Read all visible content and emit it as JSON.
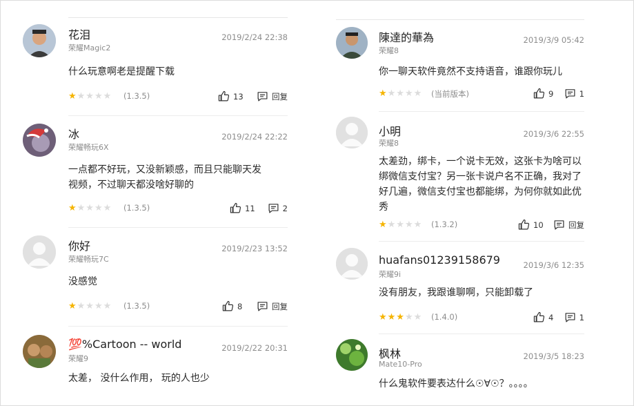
{
  "left_column": [
    {
      "name": "花泪",
      "device": "荣耀Magic2",
      "date": "2019/2/24 22:38",
      "text": "什么玩意啊老是提醒下载",
      "rating": 1,
      "version": "(1.3.5)",
      "likes": "13",
      "reply": "回复",
      "avatar": "avatar-photo-man"
    },
    {
      "name": "冰",
      "device": "荣耀畅玩6X",
      "date": "2019/2/24 22:22",
      "text": "一点都不好玩，又没新颖感，而且只能聊天发视频，不过聊天都没啥好聊的",
      "rating": 1,
      "version": "(1.3.5)",
      "likes": "11",
      "reply": "2",
      "avatar": "avatar-photo-santa"
    },
    {
      "name": "你好",
      "device": "荣耀畅玩7C",
      "date": "2019/2/23 13:52",
      "text": "没感觉",
      "rating": 1,
      "version": "(1.3.5)",
      "likes": "8",
      "reply": "回复",
      "avatar": "avatar-default"
    },
    {
      "name": "💯%Cartoon -- world",
      "device": "荣耀9",
      "date": "2019/2/22 20:31",
      "text": "太差， 没什么作用， 玩的人也少",
      "rating": 0,
      "version": "",
      "likes": "",
      "reply": "",
      "avatar": "avatar-photo-cartoon"
    }
  ],
  "right_column": [
    {
      "name": "陳達的華為",
      "device": "荣耀8",
      "date": "2019/3/9 05:42",
      "text": "你一聊天软件竟然不支持语音，谁跟你玩儿",
      "rating": 1,
      "version": "(当前版本)",
      "likes": "9",
      "reply": "1",
      "avatar": "avatar-photo-man2"
    },
    {
      "name": "小明",
      "device": "荣耀8",
      "date": "2019/3/6 22:55",
      "text": "太差劲，绑卡，一个说卡无效，这张卡为啥可以绑微信支付宝？另一张卡说户名不正确，我对了好几遍，微信支付宝也都能绑，为何你就如此优秀",
      "rating": 1,
      "version": "(1.3.2)",
      "likes": "10",
      "reply": "回复",
      "avatar": "avatar-default"
    },
    {
      "name": "huafans01239158679",
      "device": "荣耀9i",
      "date": "2019/3/6 12:35",
      "text": "没有朋友，我跟谁聊啊，只能卸载了",
      "rating": 3,
      "version": "(1.4.0)",
      "likes": "4",
      "reply": "1",
      "avatar": "avatar-default"
    },
    {
      "name": "枫林",
      "device": "Mate10-Pro",
      "date": "2019/3/5 18:23",
      "text": "什么鬼软件要表达什么☉∀☉？。。。。",
      "rating": 0,
      "version": "",
      "likes": "",
      "reply": "",
      "avatar": "avatar-photo-green"
    }
  ],
  "colors": {
    "star_on": "#f5b400",
    "star_off": "#dcdcdc",
    "divider": "#ececec",
    "text_secondary": "#8c8c8c"
  }
}
